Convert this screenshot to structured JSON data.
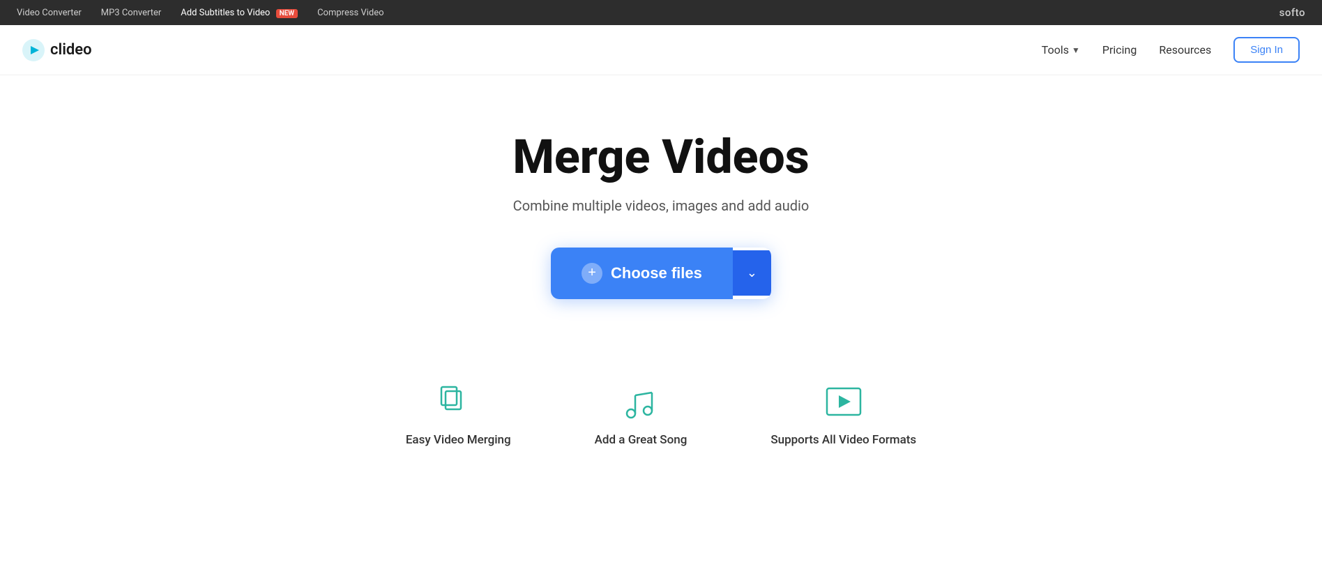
{
  "topbar": {
    "links": [
      {
        "label": "Video Converter",
        "active": false
      },
      {
        "label": "MP3 Converter",
        "active": false
      },
      {
        "label": "Add Subtitles to Video",
        "active": true,
        "badge": "NEW"
      },
      {
        "label": "Compress Video",
        "active": false
      }
    ],
    "brand": "softo"
  },
  "nav": {
    "logo_text": "clideo",
    "tools_label": "Tools",
    "pricing_label": "Pricing",
    "resources_label": "Resources",
    "sign_in_label": "Sign In"
  },
  "hero": {
    "title": "Merge Videos",
    "subtitle": "Combine multiple videos, images and add audio",
    "choose_files_label": "Choose files"
  },
  "features": [
    {
      "label": "Easy Video Merging",
      "icon": "merge-icon"
    },
    {
      "label": "Add a Great Song",
      "icon": "music-icon"
    },
    {
      "label": "Supports All Video Formats",
      "icon": "video-formats-icon"
    }
  ]
}
